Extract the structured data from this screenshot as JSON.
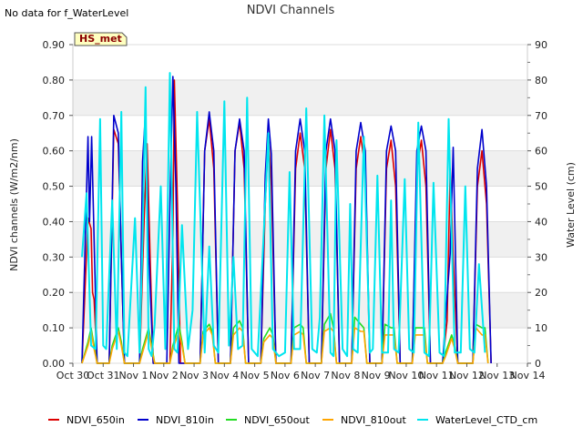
{
  "no_data_text": "No data for f_WaterLevel",
  "badge": "HS_met",
  "chart_data": {
    "type": "line",
    "title": "NDVI Channels",
    "ylabel": "NDVI channels (W/m2/nm)",
    "ylabel_right": "Water Level (cm)",
    "xlabel": "",
    "ylim": [
      0,
      0.9
    ],
    "ylim_right": [
      0,
      90
    ],
    "xlim": [
      0,
      15
    ],
    "yticks": [
      "0.00",
      "0.10",
      "0.20",
      "0.30",
      "0.40",
      "0.50",
      "0.60",
      "0.70",
      "0.80",
      "0.90"
    ],
    "yticks_right": [
      "0",
      "10",
      "20",
      "30",
      "40",
      "50",
      "60",
      "70",
      "80",
      "90"
    ],
    "xticks": [
      "Oct 30",
      "Oct 31",
      "Nov 1",
      "Nov 2",
      "Nov 3",
      "Nov 4",
      "Nov 5",
      "Nov 6",
      "Nov 7",
      "Nov 8",
      "Nov 9",
      "Nov 10",
      "Nov 11",
      "Nov 12",
      "Nov 13",
      "Nov 14"
    ],
    "grid": true,
    "legend_position": "bottom",
    "series": [
      {
        "name": "NDVI_650in",
        "color": "#dd0000",
        "axis": "left",
        "x": [
          0.3,
          0.5,
          0.6,
          0.65,
          0.7,
          0.8,
          1.2,
          1.35,
          1.5,
          1.6,
          1.7,
          2.2,
          2.35,
          2.45,
          2.55,
          2.65,
          3.2,
          3.3,
          3.35,
          3.45,
          3.55,
          4.2,
          4.35,
          4.5,
          4.65,
          4.8,
          5.2,
          5.35,
          5.5,
          5.65,
          5.8,
          6.2,
          6.35,
          6.45,
          6.55,
          6.7,
          7.2,
          7.35,
          7.5,
          7.65,
          7.8,
          8.2,
          8.35,
          8.5,
          8.65,
          8.8,
          9.2,
          9.35,
          9.5,
          9.65,
          9.8,
          10.2,
          10.35,
          10.5,
          10.65,
          10.8,
          11.2,
          11.35,
          11.5,
          11.65,
          11.8,
          12.2,
          12.35,
          12.45,
          12.55,
          12.7,
          13.2,
          13.35,
          13.5,
          13.65,
          13.8
        ],
        "y": [
          0,
          0.41,
          0.38,
          0.2,
          0.18,
          0,
          0,
          0.66,
          0.62,
          0.3,
          0,
          0,
          0.4,
          0.62,
          0.3,
          0,
          0,
          0.36,
          0.8,
          0.45,
          0,
          0,
          0.6,
          0.69,
          0.55,
          0,
          0,
          0.6,
          0.68,
          0.55,
          0,
          0,
          0.45,
          0.65,
          0.5,
          0,
          0,
          0.55,
          0.65,
          0.55,
          0,
          0,
          0.55,
          0.66,
          0.55,
          0,
          0,
          0.55,
          0.64,
          0.55,
          0,
          0,
          0.55,
          0.63,
          0.5,
          0,
          0,
          0.55,
          0.63,
          0.5,
          0,
          0,
          0.12,
          0.55,
          0.3,
          0,
          0,
          0.5,
          0.6,
          0.45,
          0
        ]
      },
      {
        "name": "NDVI_810in",
        "color": "#0000cc",
        "axis": "left",
        "x": [
          0.3,
          0.5,
          0.55,
          0.62,
          0.7,
          0.8,
          1.2,
          1.35,
          1.5,
          1.6,
          1.7,
          2.2,
          2.3,
          2.4,
          2.5,
          2.65,
          3.1,
          3.2,
          3.3,
          3.4,
          3.5,
          4.2,
          4.35,
          4.5,
          4.65,
          4.8,
          5.2,
          5.35,
          5.5,
          5.65,
          5.8,
          6.2,
          6.35,
          6.45,
          6.55,
          6.7,
          7.2,
          7.35,
          7.5,
          7.65,
          7.8,
          8.2,
          8.35,
          8.5,
          8.65,
          8.8,
          9.2,
          9.35,
          9.5,
          9.65,
          9.8,
          10.2,
          10.35,
          10.5,
          10.65,
          10.8,
          11.2,
          11.35,
          11.5,
          11.65,
          11.8,
          12.2,
          12.3,
          12.45,
          12.55,
          12.7,
          13.2,
          13.35,
          13.5,
          13.65,
          13.8
        ],
        "y": [
          0,
          0.64,
          0.4,
          0.64,
          0.35,
          0,
          0,
          0.7,
          0.65,
          0.3,
          0,
          0,
          0.57,
          0.71,
          0.32,
          0,
          0,
          0.45,
          0.81,
          0.5,
          0,
          0,
          0.6,
          0.71,
          0.6,
          0,
          0,
          0.6,
          0.69,
          0.6,
          0,
          0,
          0.53,
          0.69,
          0.59,
          0,
          0,
          0.6,
          0.69,
          0.6,
          0,
          0,
          0.6,
          0.69,
          0.6,
          0,
          0,
          0.6,
          0.68,
          0.6,
          0,
          0,
          0.6,
          0.67,
          0.6,
          0,
          0,
          0.6,
          0.67,
          0.6,
          0,
          0,
          0.13,
          0.31,
          0.61,
          0,
          0,
          0.55,
          0.66,
          0.5,
          0
        ]
      },
      {
        "name": "NDVI_650out",
        "color": "#22dd22",
        "axis": "left",
        "x": [
          0.3,
          0.5,
          0.6,
          0.7,
          0.8,
          1.2,
          1.3,
          1.5,
          1.6,
          1.7,
          2.2,
          2.3,
          2.5,
          2.6,
          2.7,
          3.2,
          3.3,
          3.5,
          3.6,
          3.7,
          4.2,
          4.3,
          4.5,
          4.6,
          4.7,
          5.2,
          5.3,
          5.5,
          5.6,
          5.7,
          6.2,
          6.3,
          6.5,
          6.6,
          6.7,
          7.2,
          7.3,
          7.5,
          7.6,
          7.7,
          8.2,
          8.3,
          8.5,
          8.6,
          8.7,
          9.2,
          9.3,
          9.5,
          9.6,
          9.7,
          10.2,
          10.3,
          10.5,
          10.6,
          10.7,
          11.2,
          11.3,
          11.5,
          11.6,
          11.7,
          12.2,
          12.3,
          12.5,
          12.6,
          12.7,
          13.2,
          13.3,
          13.5,
          13.6,
          13.7
        ],
        "y": [
          0,
          0.06,
          0.1,
          0.05,
          0,
          0,
          0.05,
          0.1,
          0.06,
          0,
          0,
          0.04,
          0.1,
          0.05,
          0,
          0,
          0.05,
          0.11,
          0.06,
          0,
          0,
          0.09,
          0.11,
          0.09,
          0,
          0,
          0.1,
          0.12,
          0.1,
          0,
          0,
          0.07,
          0.1,
          0.08,
          0,
          0,
          0.1,
          0.11,
          0.1,
          0,
          0,
          0.11,
          0.14,
          0.1,
          0,
          0,
          0.13,
          0.11,
          0.1,
          0,
          0,
          0.11,
          0.1,
          0.1,
          0,
          0,
          0.1,
          0.1,
          0.1,
          0,
          0,
          0.03,
          0.08,
          0.05,
          0,
          0,
          0.11,
          0.1,
          0.1,
          0
        ]
      },
      {
        "name": "NDVI_810out",
        "color": "#ffa500",
        "axis": "left",
        "x": [
          0.3,
          0.5,
          0.6,
          0.7,
          0.8,
          1.2,
          1.3,
          1.5,
          1.6,
          1.7,
          2.2,
          2.3,
          2.5,
          2.6,
          2.7,
          3.2,
          3.3,
          3.5,
          3.6,
          3.7,
          4.2,
          4.3,
          4.5,
          4.6,
          4.7,
          5.2,
          5.3,
          5.5,
          5.6,
          5.7,
          6.2,
          6.3,
          6.5,
          6.6,
          6.7,
          7.2,
          7.3,
          7.5,
          7.6,
          7.7,
          8.2,
          8.3,
          8.5,
          8.6,
          8.7,
          9.2,
          9.3,
          9.5,
          9.6,
          9.7,
          10.2,
          10.3,
          10.5,
          10.6,
          10.7,
          11.2,
          11.3,
          11.5,
          11.6,
          11.7,
          12.2,
          12.3,
          12.5,
          12.6,
          12.7,
          13.2,
          13.3,
          13.5,
          13.6,
          13.7
        ],
        "y": [
          0,
          0.05,
          0.09,
          0.04,
          0,
          0,
          0.04,
          0.09,
          0.05,
          0,
          0,
          0.03,
          0.09,
          0.04,
          0,
          0,
          0.04,
          0.09,
          0.05,
          0,
          0,
          0.08,
          0.1,
          0.08,
          0,
          0,
          0.08,
          0.1,
          0.09,
          0,
          0,
          0.06,
          0.08,
          0.07,
          0,
          0,
          0.08,
          0.09,
          0.08,
          0,
          0,
          0.09,
          0.1,
          0.09,
          0,
          0,
          0.1,
          0.09,
          0.09,
          0,
          0,
          0.08,
          0.08,
          0.08,
          0,
          0,
          0.08,
          0.08,
          0.08,
          0,
          0,
          0.02,
          0.07,
          0.04,
          0,
          0,
          0.1,
          0.08,
          0.08,
          0
        ]
      },
      {
        "name": "WaterLevel_CTD_cm",
        "color": "#00e5ee",
        "axis": "right",
        "x": [
          0.3,
          0.45,
          0.6,
          0.75,
          0.9,
          1.0,
          1.1,
          1.3,
          1.45,
          1.6,
          1.7,
          1.8,
          2.05,
          2.2,
          2.3,
          2.4,
          2.5,
          2.6,
          2.7,
          2.9,
          3.05,
          3.2,
          3.35,
          3.45,
          3.6,
          3.8,
          3.95,
          4.1,
          4.35,
          4.5,
          4.65,
          4.8,
          5.0,
          5.15,
          5.3,
          5.45,
          5.6,
          5.75,
          5.9,
          6.1,
          6.3,
          6.45,
          6.6,
          6.8,
          7.0,
          7.15,
          7.3,
          7.5,
          7.7,
          7.9,
          8.05,
          8.15,
          8.3,
          8.5,
          8.6,
          8.7,
          8.9,
          9.05,
          9.15,
          9.25,
          9.4,
          9.6,
          9.8,
          9.9,
          10.05,
          10.2,
          10.4,
          10.5,
          10.6,
          10.75,
          10.95,
          11.1,
          11.25,
          11.4,
          11.6,
          11.75,
          11.9,
          12.1,
          12.25,
          12.4,
          12.6,
          12.8,
          12.95,
          13.1,
          13.25,
          13.4,
          13.6
        ],
        "y": [
          30,
          48,
          5,
          4,
          69,
          5,
          4,
          46,
          4,
          71,
          3,
          2,
          41,
          3,
          35,
          78,
          4,
          2,
          11,
          50,
          4,
          82,
          4,
          3,
          39,
          4,
          15,
          71,
          3,
          33,
          5,
          3,
          74,
          5,
          30,
          4,
          5,
          75,
          4,
          2,
          37,
          65,
          4,
          2,
          3,
          54,
          4,
          4,
          72,
          4,
          3,
          13,
          70,
          3,
          2,
          63,
          4,
          2,
          45,
          4,
          3,
          64,
          3,
          4,
          53,
          3,
          3,
          46,
          4,
          3,
          52,
          4,
          3,
          68,
          3,
          2,
          51,
          3,
          2,
          69,
          3,
          3,
          50,
          4,
          3,
          28,
          3
        ]
      }
    ]
  }
}
